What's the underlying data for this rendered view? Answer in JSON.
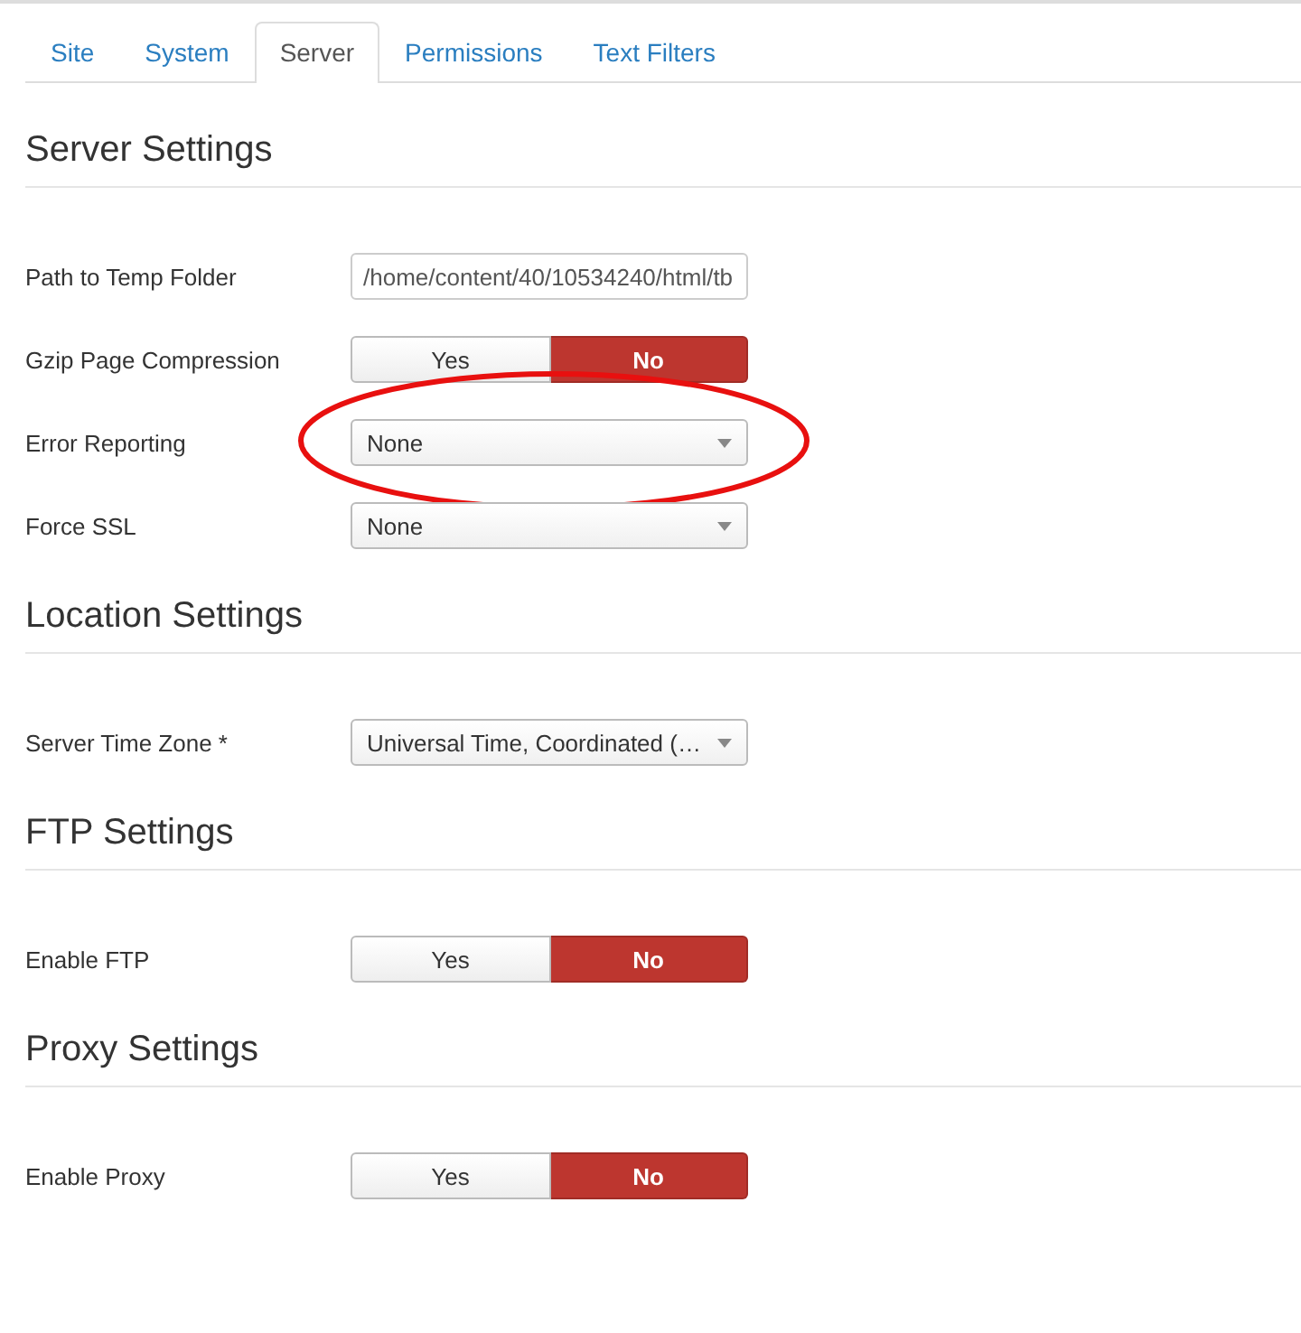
{
  "tabs": [
    {
      "label": "Site",
      "selected": false
    },
    {
      "label": "System",
      "selected": false
    },
    {
      "label": "Server",
      "selected": true
    },
    {
      "label": "Permissions",
      "selected": false
    },
    {
      "label": "Text Filters",
      "selected": false
    }
  ],
  "sections": [
    {
      "title": "Server Settings",
      "fields": [
        {
          "kind": "text",
          "label": "Path to Temp Folder",
          "value": "/home/content/40/10534240/html/tb"
        },
        {
          "kind": "toggle",
          "label": "Gzip Page Compression",
          "options": [
            {
              "label": "Yes",
              "selected": false
            },
            {
              "label": "No",
              "selected": true
            }
          ]
        },
        {
          "kind": "select",
          "label": "Error Reporting",
          "value": "None",
          "highlighted": true
        },
        {
          "kind": "select",
          "label": "Force SSL",
          "value": "None",
          "highlighted": false
        }
      ]
    },
    {
      "title": "Location Settings",
      "fields": [
        {
          "kind": "select",
          "label": "Server Time Zone *",
          "value": "Universal Time, Coordinated (…",
          "highlighted": false
        }
      ]
    },
    {
      "title": "FTP Settings",
      "fields": [
        {
          "kind": "toggle",
          "label": "Enable FTP",
          "options": [
            {
              "label": "Yes",
              "selected": false
            },
            {
              "label": "No",
              "selected": true
            }
          ]
        }
      ]
    },
    {
      "title": "Proxy Settings",
      "fields": [
        {
          "kind": "toggle",
          "label": "Enable Proxy",
          "options": [
            {
              "label": "Yes",
              "selected": false
            },
            {
              "label": "No",
              "selected": true
            }
          ]
        }
      ]
    }
  ]
}
